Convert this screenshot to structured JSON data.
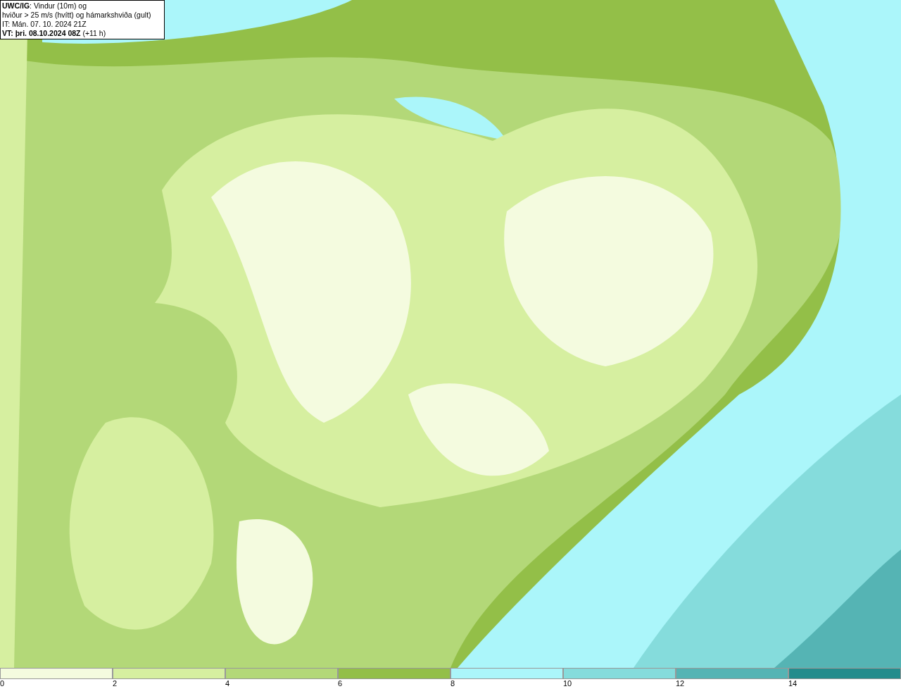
{
  "info_box": {
    "lines": [
      "**UWC/IG**: Vindur (10m) og",
      "hviður > 25 m/s (hvítt) og hámarkshviða (gult)",
      "IT: Mán. 07. 10. 2024 21Z",
      "**VT: þri. 08.10.2024 08Z** (+11 h)"
    ]
  },
  "legend": {
    "bins": [
      {
        "label": "0",
        "color": "#f4fbdf"
      },
      {
        "label": "2",
        "color": "#d6efa0"
      },
      {
        "label": "4",
        "color": "#b3d878"
      },
      {
        "label": "6",
        "color": "#93bf48"
      },
      {
        "label": "8",
        "color": "#abf6fa"
      },
      {
        "label": "10",
        "color": "#85dcdc"
      },
      {
        "label": "12",
        "color": "#55b4b4"
      },
      {
        "label": "14",
        "color": "#248c8c"
      }
    ]
  }
}
